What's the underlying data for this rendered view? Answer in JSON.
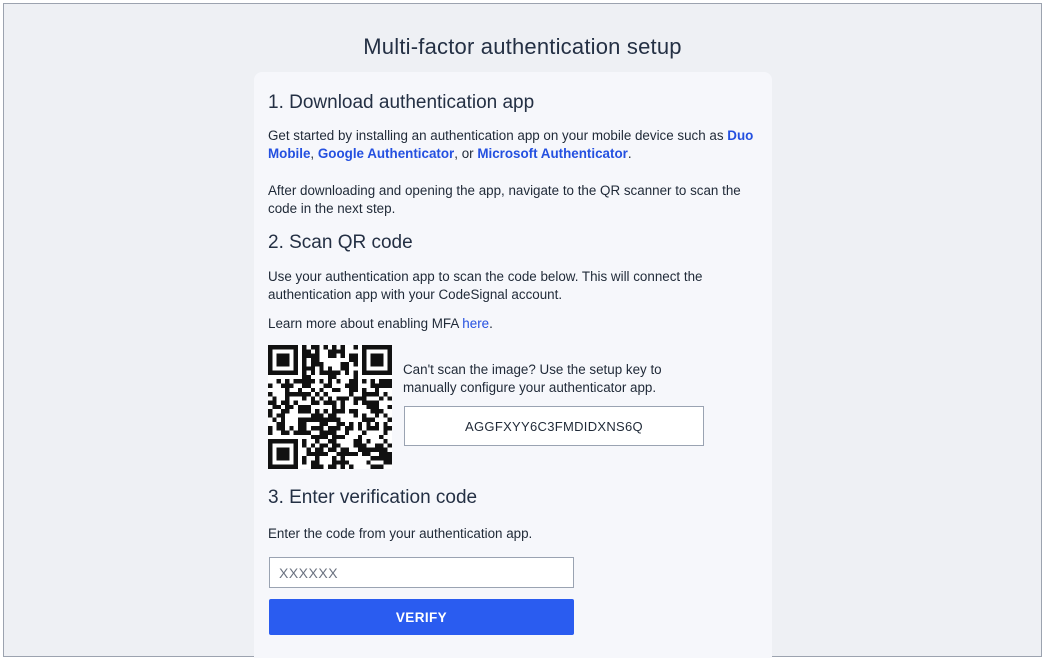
{
  "page": {
    "title": "Multi-factor authentication setup"
  },
  "step1": {
    "heading": "1. Download authentication app",
    "intro_before": "Get started by installing an authentication app on your mobile device such as ",
    "app_duo": "Duo Mobile",
    "sep1": ", ",
    "app_google": "Google Authenticator",
    "sep2": ", or ",
    "app_microsoft": "Microsoft Authenticator",
    "end": ".",
    "after": "After downloading and opening the app, navigate to the QR scanner to scan the code in the next step."
  },
  "step2": {
    "heading": "2. Scan QR code",
    "instructions": "Use your authentication app to scan the code below. This will connect the authentication app with your CodeSignal account.",
    "learn_more_before": "Learn more about enabling MFA ",
    "learn_more_link": "here",
    "learn_more_end": ".",
    "cant_scan": "Can't scan the image? Use the setup key to manually configure your authenticator app.",
    "setup_key": "AGGFXYY6C3FMDIDXNS6Q",
    "qr_icon": "qr-code-icon"
  },
  "step3": {
    "heading": "3. Enter verification code",
    "instructions": "Enter the code from your authentication app.",
    "input_placeholder": "XXXXXX",
    "input_value": "",
    "verify_label": "VERIFY"
  },
  "colors": {
    "background": "#eef0f4",
    "card": "#f6f7fb",
    "link": "#2450e0",
    "primary_button": "#2a5cf0"
  }
}
